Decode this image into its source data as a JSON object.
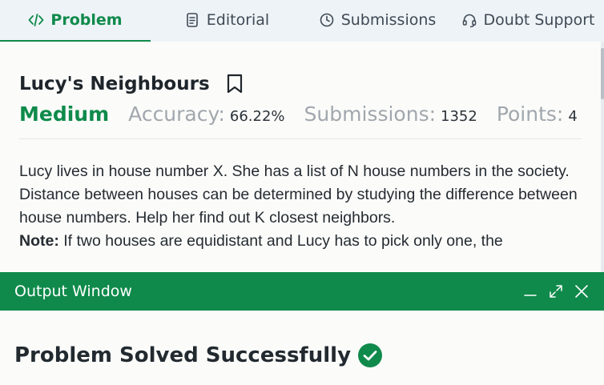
{
  "tabs": {
    "problem": "Problem",
    "editorial": "Editorial",
    "submissions": "Submissions",
    "doubt": "Doubt Support"
  },
  "problem": {
    "title": "Lucy's Neighbours",
    "difficulty": "Medium",
    "accuracy_label": "Accuracy:",
    "accuracy_value": "66.22%",
    "submissions_label": "Submissions:",
    "submissions_value": "1352",
    "points_label": "Points:",
    "points_value": "4",
    "description": "Lucy lives in house number X. She has a list of N house numbers in the society. Distance between houses can be determined by studying the difference between house numbers. Help her find out K closest neighbors.",
    "note_label": "Note:",
    "note_text": "If two houses are equidistant and Lucy has to pick only one, the"
  },
  "output": {
    "title": "Output Window",
    "result": "Problem Solved Successfully"
  },
  "colors": {
    "accent": "#0f8a4b",
    "tab_bar": "#eef3f7",
    "muted_label": "#a1a7ad"
  },
  "icons": {
    "problem": "code-icon",
    "editorial": "document-icon",
    "submissions": "clock-icon",
    "doubt": "headset-icon",
    "bookmark": "bookmark-icon",
    "minimize": "minimize-icon",
    "expand": "expand-icon",
    "close": "close-icon",
    "success": "check-circle-icon"
  }
}
